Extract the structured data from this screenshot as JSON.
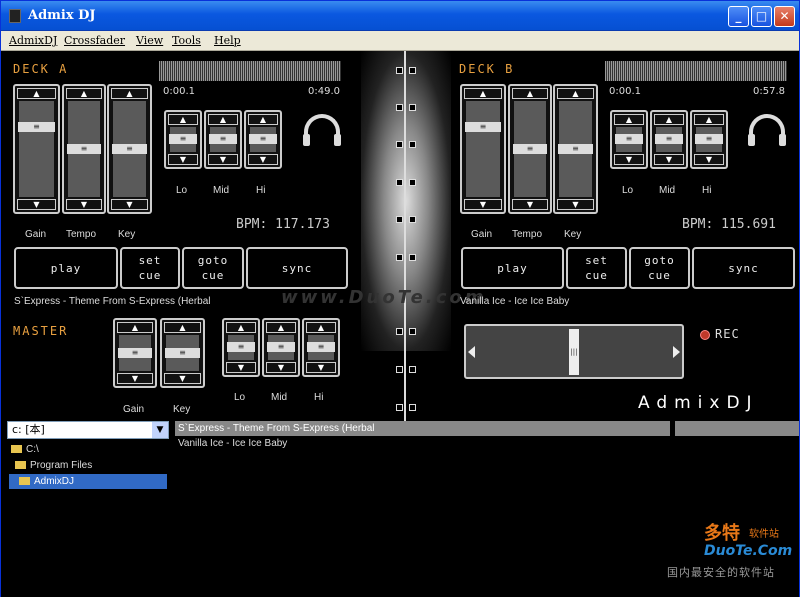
{
  "window": {
    "title": "Admix DJ"
  },
  "menu": [
    "AdmixDJ",
    "Crossfader",
    "View",
    "Tools",
    "Help"
  ],
  "deck_a": {
    "title": "DECK A",
    "time_elapsed": "0:00.1",
    "time_total": "0:49.0",
    "bpm": "BPM: 117.173",
    "track": "S`Express - Theme From S-Express (Herbal",
    "fader_labels": [
      "Gain",
      "Tempo",
      "Key"
    ],
    "eq_labels": [
      "Lo",
      "Mid",
      "Hi"
    ],
    "buttons": {
      "play": "play",
      "set_cue": "set\ncue",
      "goto_cue": "goto\ncue",
      "sync": "sync"
    }
  },
  "deck_b": {
    "title": "DECK B",
    "time_elapsed": "0:00.1",
    "time_total": "0:57.8",
    "bpm": "BPM: 115.691",
    "track": "Vanilla Ice - Ice Ice Baby",
    "fader_labels": [
      "Gain",
      "Tempo",
      "Key"
    ],
    "eq_labels": [
      "Lo",
      "Mid",
      "Hi"
    ],
    "buttons": {
      "play": "play",
      "set_cue": "set\ncue",
      "goto_cue": "goto\ncue",
      "sync": "sync"
    }
  },
  "master": {
    "title": "MASTER",
    "fader_labels": [
      "Gain",
      "Key"
    ],
    "eq_labels": [
      "Lo",
      "Mid",
      "Hi"
    ]
  },
  "rec": "REC",
  "brand": "AdmixDJ",
  "browser": {
    "drive": "c: [本]",
    "tree": [
      "C:\\",
      "Program Files",
      "AdmixDJ"
    ]
  },
  "playlist": [
    "S`Express - Theme From S-Express (Herbal",
    "Vanilla Ice - Ice Ice Baby"
  ],
  "watermark": {
    "cn_logo": "多特",
    "cn_small": "软件站",
    "url": "DuoTe.Com",
    "slogan": "国内最安全的软件站",
    "center": "www.DuoTe.com"
  },
  "colors": {
    "accent_orange": "#e8a040",
    "selection": "#316ac5",
    "rec": "#c0392b"
  }
}
